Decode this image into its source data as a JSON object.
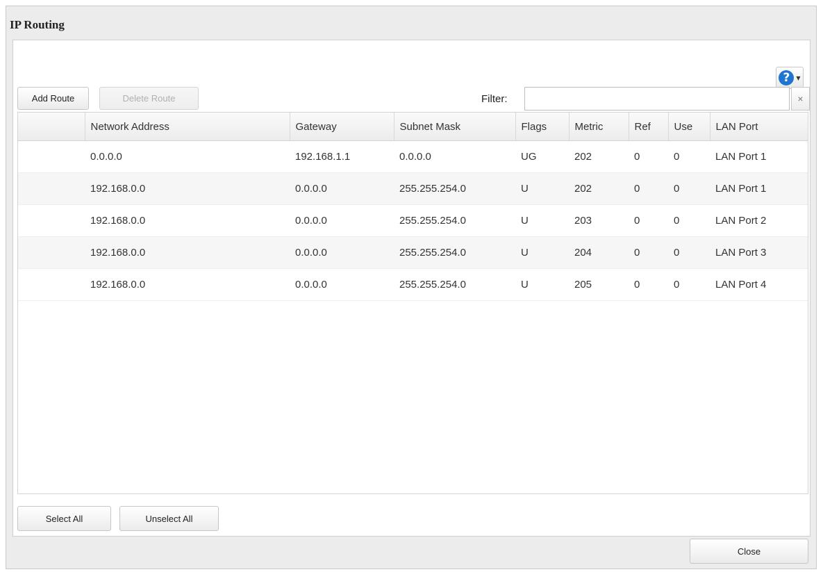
{
  "window": {
    "title": "IP Routing"
  },
  "toolbar": {
    "add_route": "Add Route",
    "delete_route": "Delete Route"
  },
  "filter": {
    "label": "Filter:",
    "value": "",
    "clear": "×"
  },
  "help": {
    "symbol": "?",
    "caret": "▼"
  },
  "table": {
    "columns": [
      "",
      "Network Address",
      "Gateway",
      "Subnet Mask",
      "Flags",
      "Metric",
      "Ref",
      "Use",
      "LAN Port"
    ],
    "rows": [
      [
        "0.0.0.0",
        "192.168.1.1",
        "0.0.0.0",
        "UG",
        "202",
        "0",
        "0",
        "LAN Port 1"
      ],
      [
        "192.168.0.0",
        "0.0.0.0",
        "255.255.254.0",
        "U",
        "202",
        "0",
        "0",
        "LAN Port 1"
      ],
      [
        "192.168.0.0",
        "0.0.0.0",
        "255.255.254.0",
        "U",
        "203",
        "0",
        "0",
        "LAN Port 2"
      ],
      [
        "192.168.0.0",
        "0.0.0.0",
        "255.255.254.0",
        "U",
        "204",
        "0",
        "0",
        "LAN Port 3"
      ],
      [
        "192.168.0.0",
        "0.0.0.0",
        "255.255.254.0",
        "U",
        "205",
        "0",
        "0",
        "LAN Port 4"
      ]
    ]
  },
  "footer": {
    "select_all": "Select All",
    "unselect_all": "Unselect All"
  },
  "dialog": {
    "close": "Close"
  },
  "colors": {
    "help_icon": "#1f76cf",
    "row_alt": "#f6f6f6",
    "dialog_bg": "#ececec"
  }
}
